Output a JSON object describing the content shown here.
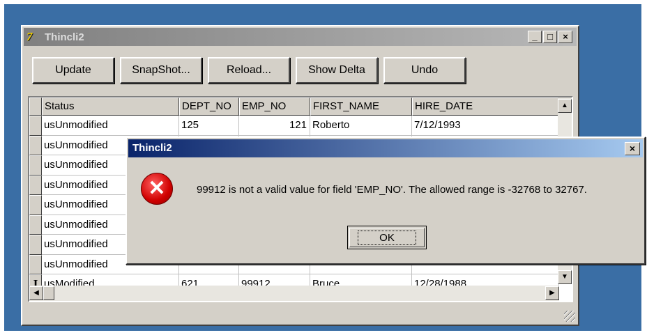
{
  "window": {
    "title": "Thincli2",
    "minimize_glyph": "_",
    "maximize_glyph": "□",
    "close_glyph": "×"
  },
  "toolbar": {
    "buttons": [
      "Update",
      "SnapShot...",
      "Reload...",
      "Show Delta",
      "Undo"
    ]
  },
  "grid": {
    "columns": [
      "Status",
      "DEPT_NO",
      "EMP_NO",
      "FIRST_NAME",
      "HIRE_DATE"
    ],
    "rows": [
      {
        "indicator": "",
        "status": "usUnmodified",
        "dept_no": "125",
        "emp_no": "121",
        "first_name": "Roberto",
        "hire_date": "7/12/1993"
      },
      {
        "indicator": "",
        "status": "usUnmodified",
        "dept_no": "",
        "emp_no": "",
        "first_name": "",
        "hire_date": ""
      },
      {
        "indicator": "",
        "status": "usUnmodified",
        "dept_no": "",
        "emp_no": "",
        "first_name": "",
        "hire_date": ""
      },
      {
        "indicator": "",
        "status": "usUnmodified",
        "dept_no": "",
        "emp_no": "",
        "first_name": "",
        "hire_date": ""
      },
      {
        "indicator": "",
        "status": "usUnmodified",
        "dept_no": "",
        "emp_no": "",
        "first_name": "",
        "hire_date": ""
      },
      {
        "indicator": "",
        "status": "usUnmodified",
        "dept_no": "",
        "emp_no": "",
        "first_name": "",
        "hire_date": ""
      },
      {
        "indicator": "",
        "status": "usUnmodified",
        "dept_no": "",
        "emp_no": "",
        "first_name": "",
        "hire_date": ""
      },
      {
        "indicator": "",
        "status": "usUnmodified",
        "dept_no": "",
        "emp_no": "",
        "first_name": "",
        "hire_date": ""
      },
      {
        "indicator": "I",
        "status": "usModified",
        "dept_no": "621",
        "emp_no": "99912",
        "first_name": "Bruce",
        "hire_date": "12/28/1988"
      }
    ]
  },
  "dialog": {
    "title": "Thincli2",
    "close_glyph": "×",
    "icon_glyph": "✕",
    "message": "99912 is not a valid value for field 'EMP_NO'. The allowed range is -32768 to 32767.",
    "ok_label": "OK"
  },
  "scroll": {
    "up_glyph": "▲",
    "down_glyph": "▼",
    "left_glyph": "◀",
    "right_glyph": "▶"
  }
}
